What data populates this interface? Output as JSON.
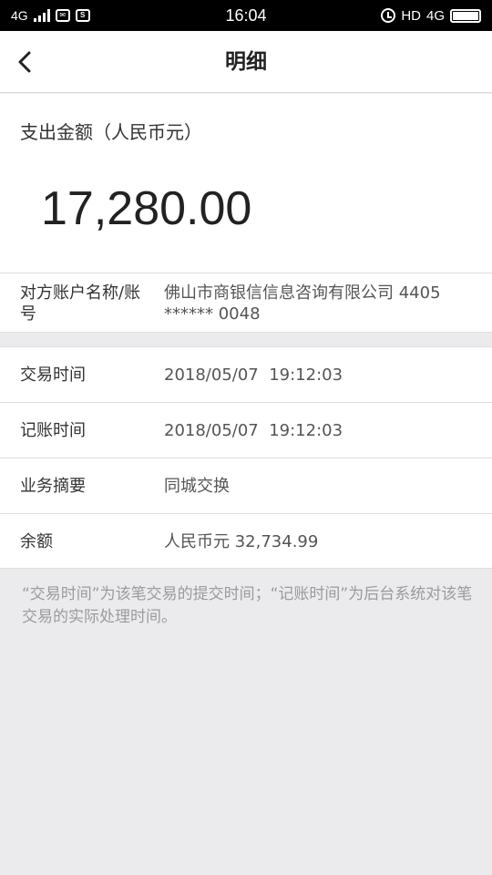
{
  "status_bar": {
    "network": "4G",
    "time": "16:04",
    "hd_label": "HD",
    "network_right": "4G",
    "battery_level": 1.0
  },
  "nav": {
    "title": "明细"
  },
  "amount": {
    "label": "支出金额（人民币元）",
    "value": "17,280.00"
  },
  "counterparty": {
    "label": "对方账户名称/账号",
    "value": "佛山市商银信信息咨询有限公司 4405 ****** 0048"
  },
  "details": [
    {
      "label": "交易时间",
      "value": "2018/05/07  19:12:03"
    },
    {
      "label": "记账时间",
      "value": "2018/05/07  19:12:03"
    },
    {
      "label": "业务摘要",
      "value": "同城交换"
    },
    {
      "label": "余额",
      "value": "人民币元 32,734.99"
    }
  ],
  "footnote": "“交易时间”为该笔交易的提交时间；“记账时间”为后台系统对该笔交易的实际处理时间。"
}
